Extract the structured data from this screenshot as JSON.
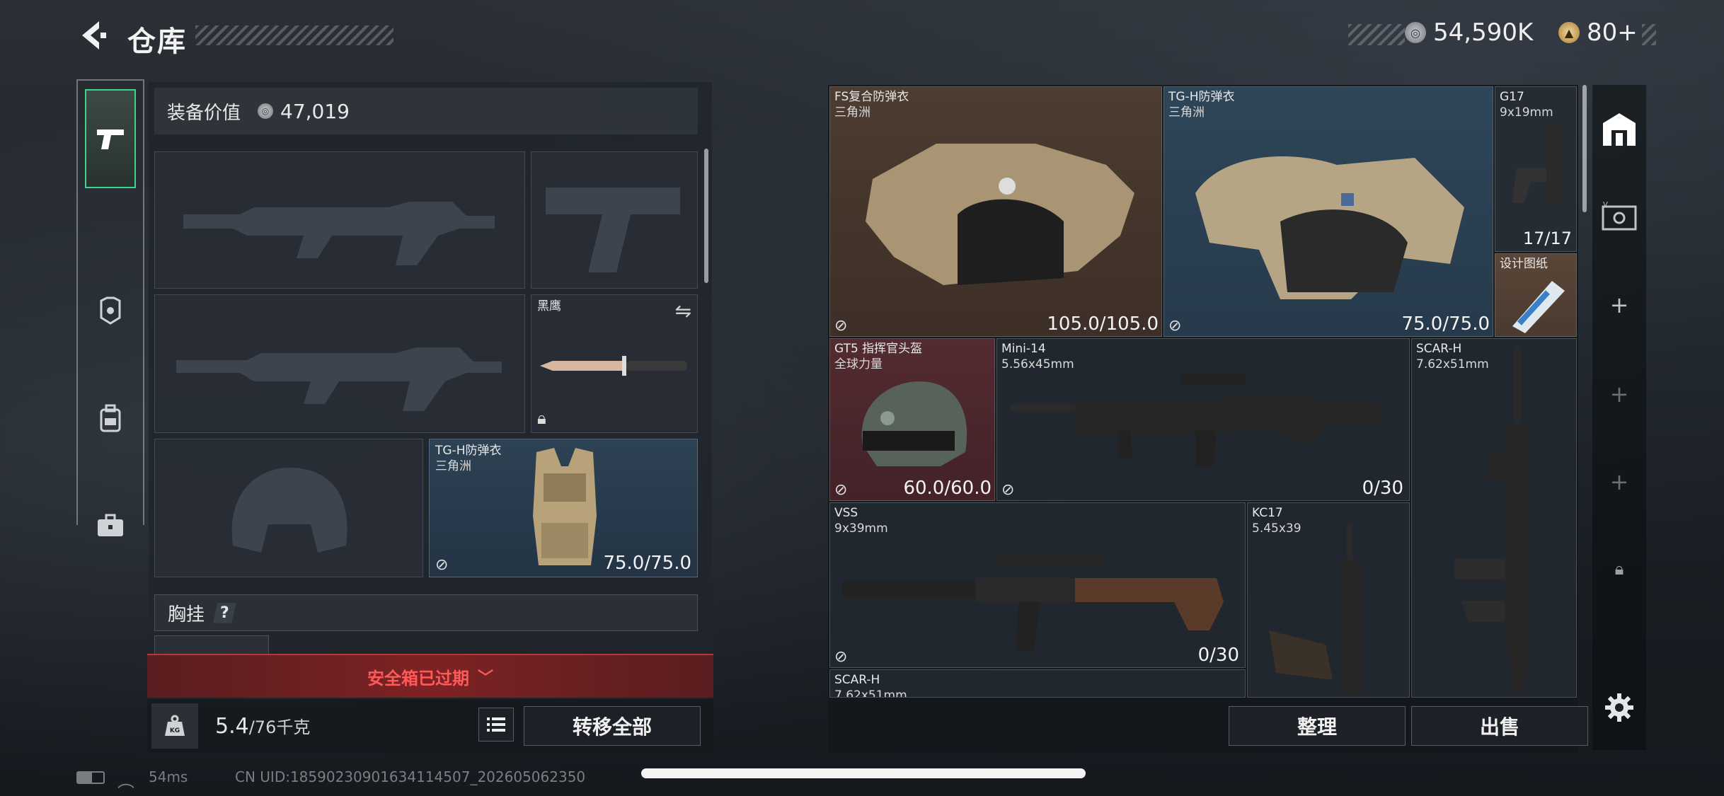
{
  "header": {
    "back_icon": "back-arrow-icon",
    "title": "仓库",
    "currency1": {
      "icon": "coin-icon",
      "value": "54,590K"
    },
    "currency2": {
      "icon": "triangle-coin-icon",
      "value": "80+"
    }
  },
  "side_tabs": [
    {
      "icon": "pistol-icon",
      "active": true
    },
    {
      "icon": "helmet-armor-icon"
    },
    {
      "icon": "backpack-icon"
    },
    {
      "icon": "toolbox-icon"
    }
  ],
  "equipment": {
    "value_label": "装备价值",
    "value": "47,019",
    "knife": {
      "name": "黑鹰",
      "swap_icon": "swap-icon",
      "lock_icon": "lock-icon"
    },
    "armor": {
      "name": "TG-H防弹衣",
      "origin": "三角洲",
      "durability": "75.0/75.0"
    },
    "chest_rig_label": "胸挂",
    "help": "?",
    "safe_box_notice": "安全箱已过期",
    "weight_icon": "weight-kg-icon",
    "weight_current": "5.4",
    "weight_max": "/76千克",
    "list_icon": "list-icon",
    "transfer_all": "转移全部"
  },
  "storage": {
    "items": [
      {
        "name": "FS复合防弹衣",
        "sub": "三角洲",
        "value": "105.0/105.0"
      },
      {
        "name": "TG-H防弹衣",
        "sub": "三角洲",
        "value": "75.0/75.0"
      },
      {
        "name": "G17",
        "sub": "9x19mm",
        "value": "17/17"
      },
      {
        "name": "设计图纸",
        "sub": "",
        "value": ""
      },
      {
        "name": "GT5 指挥官头盔",
        "sub": "全球力量",
        "value": "60.0/60.0"
      },
      {
        "name": "Mini-14",
        "sub": "5.56x45mm",
        "value": "0/30"
      },
      {
        "name": "SCAR-H",
        "sub": "7.62x51mm",
        "value": ""
      },
      {
        "name": "VSS",
        "sub": "9x39mm",
        "value": "0/30"
      },
      {
        "name": "KC17",
        "sub": "5.45x39",
        "value": ""
      },
      {
        "name": "SCAR-H",
        "sub": "7.62x51mm",
        "value": ""
      }
    ],
    "sort_button": "整理",
    "sell_button": "出售"
  },
  "rail": [
    {
      "icon": "warehouse-icon"
    },
    {
      "icon": "vault-icon"
    },
    {
      "icon": "plus-icon",
      "label": "+"
    },
    {
      "icon": "plus-icon",
      "label": "+"
    },
    {
      "icon": "plus-icon",
      "label": "+"
    },
    {
      "icon": "lock-icon"
    },
    {
      "icon": "gear-icon"
    }
  ],
  "status": {
    "battery_icon": "battery-icon",
    "wifi_icon": "wifi-icon",
    "ping": "54ms",
    "uid": "CN UID:18590230901634114507_202605062350"
  }
}
